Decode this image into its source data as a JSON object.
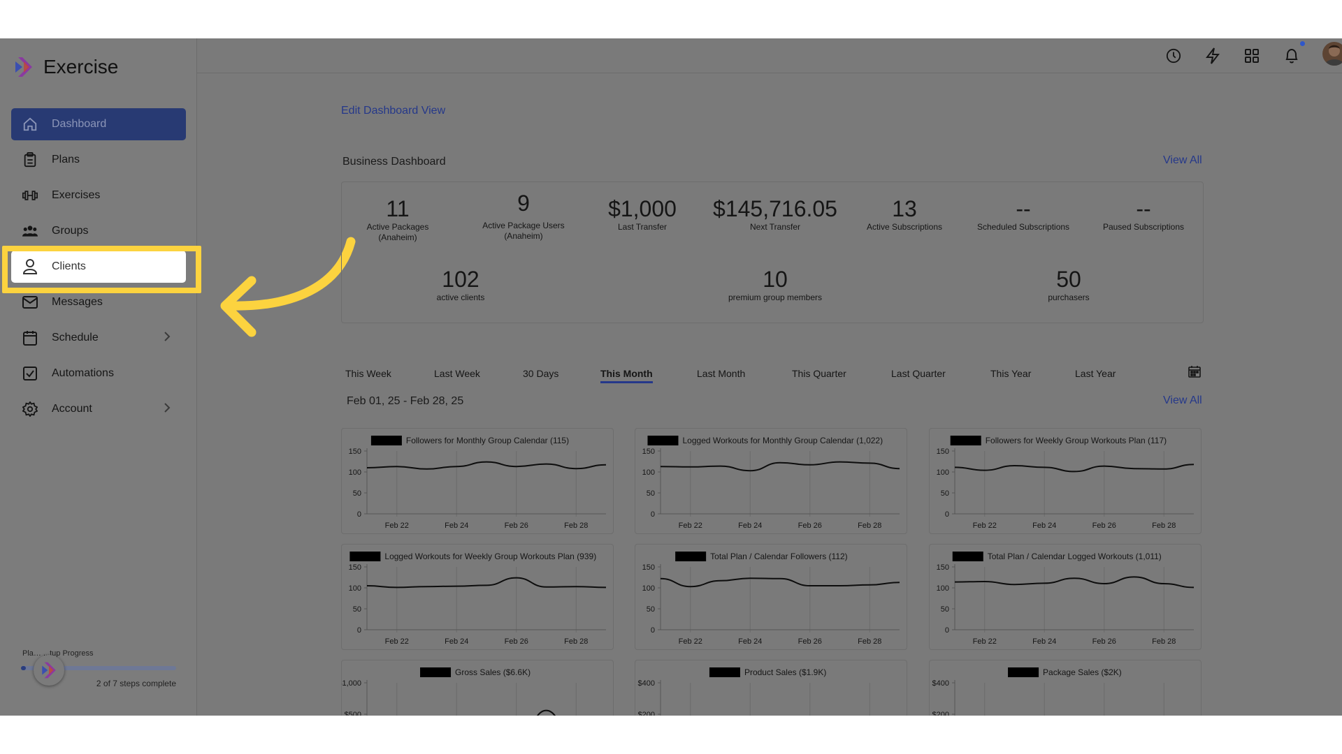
{
  "app": {
    "name": "Exercise"
  },
  "sidebar": {
    "items": [
      {
        "label": "Dashboard",
        "icon": "home-icon",
        "active": true
      },
      {
        "label": "Plans",
        "icon": "clipboard-icon"
      },
      {
        "label": "Exercises",
        "icon": "dumbbell-icon"
      },
      {
        "label": "Groups",
        "icon": "users-icon"
      },
      {
        "label": "Clients",
        "icon": "user-icon",
        "highlighted": true
      },
      {
        "label": "Messages",
        "icon": "mail-icon"
      },
      {
        "label": "Schedule",
        "icon": "calendar-icon",
        "chevron": true
      },
      {
        "label": "Automations",
        "icon": "checkbox-icon"
      },
      {
        "label": "Account",
        "icon": "gear-icon",
        "chevron": true
      }
    ],
    "progress": {
      "title": "Pla… ...tup Progress",
      "steps": "2 of 7 steps complete",
      "fraction": 0.03
    }
  },
  "topbar": {
    "icons": [
      "clock-icon",
      "bolt-icon",
      "apps-grid-icon",
      "bell-icon",
      "avatar"
    ]
  },
  "main": {
    "edit_link": "Edit Dashboard View",
    "business_title": "Business Dashboard",
    "view_all": "View All",
    "stats_row1": [
      {
        "value": "11",
        "label": "Active Packages (Anaheim)"
      },
      {
        "value": "9",
        "label": "Active Package Users (Anaheim)"
      },
      {
        "value": "$1,000",
        "label": "Last Transfer"
      },
      {
        "value": "$145,716.05",
        "label": "Next Transfer"
      },
      {
        "value": "13",
        "label": "Active Subscriptions"
      },
      {
        "value": "--",
        "label": "Scheduled Subscriptions"
      },
      {
        "value": "--",
        "label": "Paused Subscriptions"
      }
    ],
    "stats_row2": [
      {
        "value": "102",
        "label": "active clients"
      },
      {
        "value": "10",
        "label": "premium group members"
      },
      {
        "value": "50",
        "label": "purchasers"
      }
    ],
    "tabs": [
      "This Week",
      "Last Week",
      "30 Days",
      "This Month",
      "Last Month",
      "This Quarter",
      "Last Quarter",
      "This Year",
      "Last Year"
    ],
    "active_tab": "This Month",
    "date_range": "Feb 01, 25 - Feb 28, 25",
    "view_all_charts": "View All"
  },
  "chart_data": [
    {
      "type": "line",
      "title": "Followers for Monthly Group Calendar (115)",
      "xticks": [
        "Feb 22",
        "Feb 24",
        "Feb 26",
        "Feb 28"
      ],
      "yticks": [
        "0",
        "50",
        "100",
        "150"
      ],
      "ylim": [
        0,
        150
      ],
      "x": [
        21,
        22,
        23,
        24,
        25,
        26,
        27,
        28,
        29
      ],
      "values": [
        110,
        113,
        107,
        113,
        124,
        113,
        119,
        108,
        117
      ]
    },
    {
      "type": "line",
      "title": "Logged Workouts for Monthly Group Calendar (1,022)",
      "xticks": [
        "Feb 22",
        "Feb 24",
        "Feb 26",
        "Feb 28"
      ],
      "yticks": [
        "0",
        "50",
        "100",
        "150"
      ],
      "ylim": [
        0,
        150
      ],
      "x": [
        21,
        22,
        23,
        24,
        25,
        26,
        27,
        28,
        29
      ],
      "values": [
        113,
        112,
        114,
        103,
        122,
        117,
        124,
        121,
        108
      ]
    },
    {
      "type": "line",
      "title": "Followers for Weekly Group Workouts Plan (117)",
      "xticks": [
        "Feb 22",
        "Feb 24",
        "Feb 26",
        "Feb 28"
      ],
      "yticks": [
        "0",
        "50",
        "100",
        "150"
      ],
      "ylim": [
        0,
        150
      ],
      "x": [
        21,
        22,
        23,
        24,
        25,
        26,
        27,
        28,
        29
      ],
      "values": [
        111,
        104,
        115,
        111,
        101,
        114,
        108,
        107,
        118
      ]
    },
    {
      "type": "line",
      "title": "Logged Workouts for Weekly Group Workouts Plan (939)",
      "xticks": [
        "Feb 22",
        "Feb 24",
        "Feb 26",
        "Feb 28"
      ],
      "yticks": [
        "0",
        "50",
        "100",
        "150"
      ],
      "ylim": [
        0,
        150
      ],
      "x": [
        21,
        22,
        23,
        24,
        25,
        26,
        27,
        28,
        29
      ],
      "values": [
        105,
        101,
        103,
        104,
        106,
        124,
        102,
        103,
        101
      ]
    },
    {
      "type": "line",
      "title": "Total Plan / Calendar Followers (112)",
      "xticks": [
        "Feb 22",
        "Feb 24",
        "Feb 26",
        "Feb 28"
      ],
      "yticks": [
        "0",
        "50",
        "100",
        "150"
      ],
      "ylim": [
        0,
        150
      ],
      "x": [
        21,
        22,
        23,
        24,
        25,
        26,
        27,
        28,
        29
      ],
      "values": [
        122,
        103,
        117,
        123,
        122,
        105,
        105,
        107,
        113
      ]
    },
    {
      "type": "line",
      "title": "Total Plan / Calendar Logged Workouts (1,011)",
      "xticks": [
        "Feb 22",
        "Feb 24",
        "Feb 26",
        "Feb 28"
      ],
      "yticks": [
        "0",
        "50",
        "100",
        "150"
      ],
      "ylim": [
        0,
        150
      ],
      "x": [
        21,
        22,
        23,
        24,
        25,
        26,
        27,
        28,
        29
      ],
      "values": [
        114,
        115,
        108,
        111,
        123,
        110,
        126,
        110,
        101
      ]
    },
    {
      "type": "line",
      "title": "Gross Sales ($6.6K)",
      "yticks": [
        "$1,000",
        "$500"
      ],
      "ylim": [
        0,
        1000
      ],
      "x": [
        21,
        22,
        23,
        24,
        25,
        26,
        27,
        28,
        29
      ],
      "values": [
        0,
        0,
        0,
        0,
        0,
        0,
        560,
        0,
        0
      ]
    },
    {
      "type": "line",
      "title": "Product Sales ($1.9K)",
      "yticks": [
        "$400",
        "$200"
      ],
      "ylim": [
        0,
        400
      ],
      "x": [
        21,
        22,
        23,
        24,
        25,
        26,
        27,
        28,
        29
      ],
      "values": [
        0,
        0,
        0,
        0,
        0,
        0,
        0,
        0,
        0
      ]
    },
    {
      "type": "line",
      "title": "Package Sales ($2K)",
      "yticks": [
        "$400",
        "$200"
      ],
      "ylim": [
        0,
        400
      ],
      "x": [
        21,
        22,
        23,
        24,
        25,
        26,
        27,
        28,
        29
      ],
      "values": [
        0,
        0,
        0,
        0,
        0,
        0,
        0,
        0,
        0
      ]
    }
  ],
  "colors": {
    "accent": "#25388a",
    "highlight": "#fcd33f",
    "overlay_bg": "#7a7a7a"
  }
}
